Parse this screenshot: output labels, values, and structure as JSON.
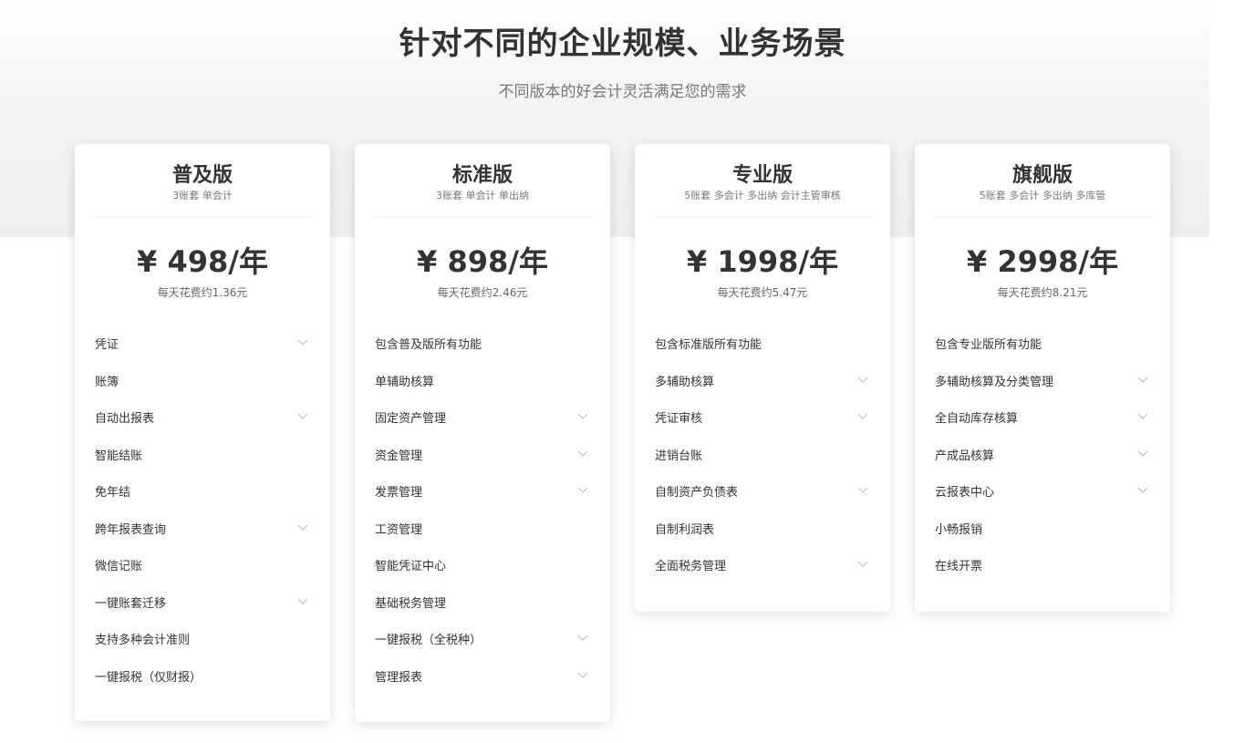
{
  "header": {
    "title": "针对不同的企业规模、业务场景",
    "subtitle": "不同版本的好会计灵活满足您的需求"
  },
  "plans": [
    {
      "name": "普及版",
      "desc": "3账套 单会计",
      "price": "¥ 498/年",
      "daily": "每天花费约1.36元",
      "features": [
        {
          "label": "凭证",
          "expandable": true
        },
        {
          "label": "账簿",
          "expandable": false
        },
        {
          "label": "自动出报表",
          "expandable": true
        },
        {
          "label": "智能结账",
          "expandable": false
        },
        {
          "label": "免年结",
          "expandable": false
        },
        {
          "label": "跨年报表查询",
          "expandable": true
        },
        {
          "label": "微信记账",
          "expandable": false
        },
        {
          "label": "一键账套迁移",
          "expandable": true
        },
        {
          "label": "支持多种会计准则",
          "expandable": false
        },
        {
          "label": "一键报税（仅财报）",
          "expandable": false
        }
      ]
    },
    {
      "name": "标准版",
      "desc": "3账套 单会计 单出纳",
      "price": "¥ 898/年",
      "daily": "每天花费约2.46元",
      "features": [
        {
          "label": "包含普及版所有功能",
          "expandable": false
        },
        {
          "label": "单辅助核算",
          "expandable": false
        },
        {
          "label": "固定资产管理",
          "expandable": true
        },
        {
          "label": "资金管理",
          "expandable": true
        },
        {
          "label": "发票管理",
          "expandable": true
        },
        {
          "label": "工资管理",
          "expandable": false
        },
        {
          "label": "智能凭证中心",
          "expandable": false
        },
        {
          "label": "基础税务管理",
          "expandable": false
        },
        {
          "label": "一键报税（全税种）",
          "expandable": true
        },
        {
          "label": "管理报表",
          "expandable": true
        }
      ]
    },
    {
      "name": "专业版",
      "desc": "5账套 多会计 多出纳 会计主管审核",
      "price": "¥ 1998/年",
      "daily": "每天花费约5.47元",
      "features": [
        {
          "label": "包含标准版所有功能",
          "expandable": false
        },
        {
          "label": "多辅助核算",
          "expandable": true
        },
        {
          "label": "凭证审核",
          "expandable": true
        },
        {
          "label": "进销台账",
          "expandable": false
        },
        {
          "label": "自制资产负债表",
          "expandable": true
        },
        {
          "label": "自制利润表",
          "expandable": false
        },
        {
          "label": "全面税务管理",
          "expandable": true
        }
      ]
    },
    {
      "name": "旗舰版",
      "desc": "5账套 多会计 多出纳 多库管",
      "price": "¥ 2998/年",
      "daily": "每天花费约8.21元",
      "features": [
        {
          "label": "包含专业版所有功能",
          "expandable": false
        },
        {
          "label": "多辅助核算及分类管理",
          "expandable": true
        },
        {
          "label": "全自动库存核算",
          "expandable": true
        },
        {
          "label": "产成品核算",
          "expandable": true
        },
        {
          "label": "云报表中心",
          "expandable": true
        },
        {
          "label": "小畅报销",
          "expandable": false
        },
        {
          "label": "在线开票",
          "expandable": false
        }
      ]
    }
  ],
  "icons": {
    "expand": "chevron-down-icon"
  },
  "colors": {
    "chevron": "#bbbbbb",
    "text": "#333333",
    "muted": "#777777"
  }
}
